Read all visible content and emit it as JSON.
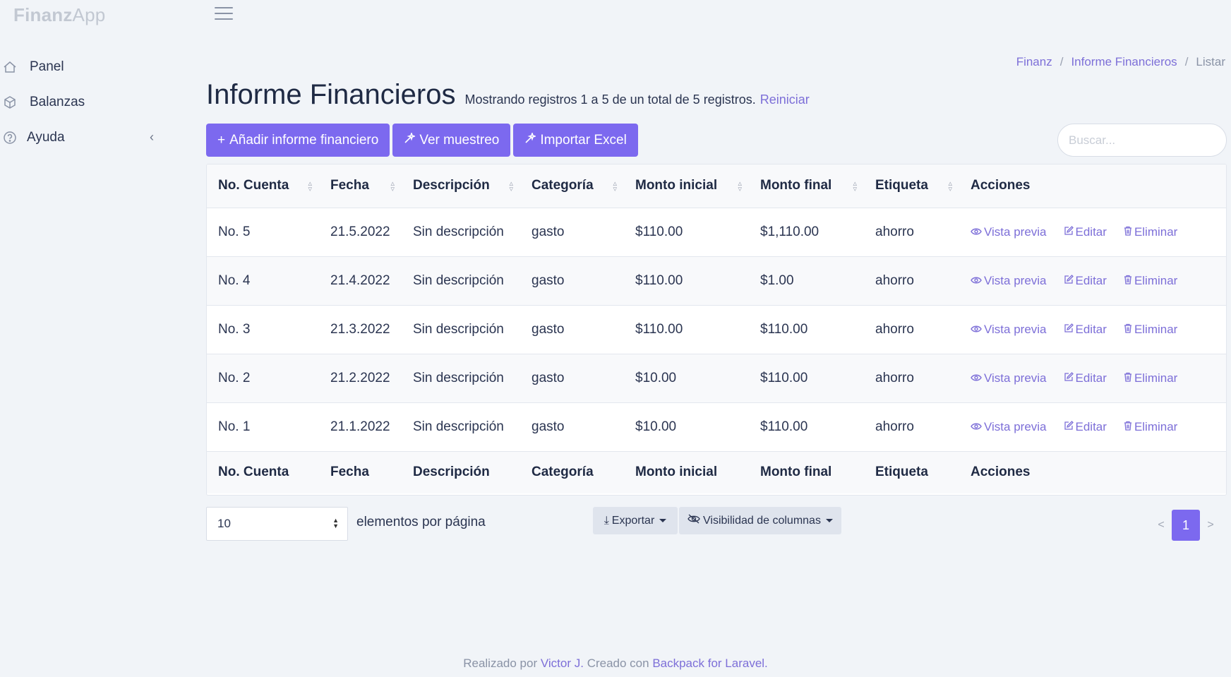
{
  "brand": {
    "bold": "Finanz",
    "light": "App"
  },
  "sidebar": {
    "items": [
      {
        "label": "Panel",
        "icon": "home-icon"
      },
      {
        "label": "Balanzas",
        "icon": "cube-icon"
      },
      {
        "label": "Ayuda",
        "icon": "help-circle-icon"
      }
    ],
    "collapse_glyph": "‹"
  },
  "breadcrumb": {
    "items": [
      "Finanz",
      "Informe Financieros",
      "Listar"
    ],
    "separator": "/"
  },
  "page": {
    "title": "Informe Financieros",
    "summary": "Mostrando registros 1 a 5 de un total de 5 registros.",
    "reset": "Reiniciar"
  },
  "toolbar": {
    "add_label": "Añadir informe financiero",
    "sample_label": "Ver muestreo",
    "import_label": "Importar Excel"
  },
  "search": {
    "placeholder": "Buscar..."
  },
  "table": {
    "headers": [
      "No. Cuenta",
      "Fecha",
      "Descripción",
      "Categoría",
      "Monto inicial",
      "Monto final",
      "Etiqueta",
      "Acciones"
    ],
    "rows": [
      [
        "No. 5",
        "21.5.2022",
        "Sin descripción",
        "gasto",
        "$110.00",
        "$1,110.00",
        "ahorro"
      ],
      [
        "No. 4",
        "21.4.2022",
        "Sin descripción",
        "gasto",
        "$110.00",
        "$1.00",
        "ahorro"
      ],
      [
        "No. 3",
        "21.3.2022",
        "Sin descripción",
        "gasto",
        "$110.00",
        "$110.00",
        "ahorro"
      ],
      [
        "No. 2",
        "21.2.2022",
        "Sin descripción",
        "gasto",
        "$10.00",
        "$110.00",
        "ahorro"
      ],
      [
        "No. 1",
        "21.1.2022",
        "Sin descripción",
        "gasto",
        "$10.00",
        "$110.00",
        "ahorro"
      ]
    ],
    "row_actions": {
      "preview": "Vista previa",
      "edit": "Editar",
      "delete": "Eliminar"
    }
  },
  "pagination": {
    "per_page_value": "10",
    "per_page_label": "elementos por página",
    "export_label": "Exportar",
    "columns_label": "Visibilidad de columnas",
    "prev": "<",
    "next": ">",
    "current_page": "1"
  },
  "footer": {
    "prefix": "Realizado por",
    "author": "Victor J.",
    "middle": "Creado con",
    "framework": "Backpack for Laravel."
  },
  "colors": {
    "accent": "#7c69ef",
    "link": "#7d6fd8",
    "background": "#f1f4f8"
  }
}
